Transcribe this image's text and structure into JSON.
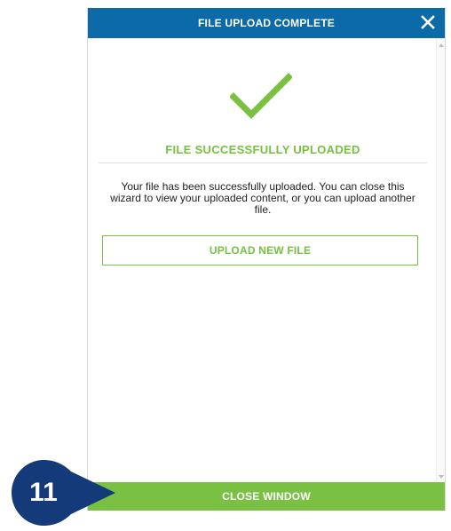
{
  "dialog": {
    "title": "FILE UPLOAD COMPLETE",
    "close_icon": "close-icon",
    "success_icon": "checkmark-icon",
    "success_heading": "FILE SUCCESSFULLY UPLOADED",
    "message": "Your file has been successfully uploaded. You can close this wizard to view your uploaded content, or you can upload another file.",
    "upload_button_label": "UPLOAD NEW FILE",
    "close_window_label": "CLOSE WINDOW"
  },
  "step_marker": {
    "number": "11",
    "color": "#153a7a"
  },
  "colors": {
    "header": "#0b6aa7",
    "accent_green": "#7ac143",
    "text": "#222222"
  }
}
